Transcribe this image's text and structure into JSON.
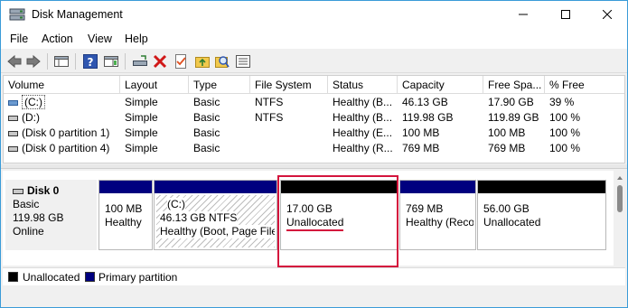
{
  "window": {
    "title": "Disk Management"
  },
  "menu": [
    "File",
    "Action",
    "View",
    "Help"
  ],
  "volume_table": {
    "headers": [
      "Volume",
      "Layout",
      "Type",
      "File System",
      "Status",
      "Capacity",
      "Free Spa...",
      "% Free"
    ],
    "rows": [
      {
        "volume": "(C:)",
        "layout": "Simple",
        "type": "Basic",
        "fs": "NTFS",
        "status": "Healthy (B...",
        "capacity": "46.13 GB",
        "free": "17.90 GB",
        "pct": "39 %"
      },
      {
        "volume": "(D:)",
        "layout": "Simple",
        "type": "Basic",
        "fs": "NTFS",
        "status": "Healthy (B...",
        "capacity": "119.98 GB",
        "free": "119.89 GB",
        "pct": "100 %"
      },
      {
        "volume": "(Disk 0 partition 1)",
        "layout": "Simple",
        "type": "Basic",
        "fs": "",
        "status": "Healthy (E...",
        "capacity": "100 MB",
        "free": "100 MB",
        "pct": "100 %"
      },
      {
        "volume": "(Disk 0 partition 4)",
        "layout": "Simple",
        "type": "Basic",
        "fs": "",
        "status": "Healthy (R...",
        "capacity": "769 MB",
        "free": "769 MB",
        "pct": "100 %"
      }
    ]
  },
  "disk": {
    "name": "Disk 0",
    "type": "Basic",
    "size": "119.98 GB",
    "state": "Online",
    "partitions": [
      {
        "line1": "100 MB",
        "line2": "Healthy",
        "kind": "primary"
      },
      {
        "title": "(C:)",
        "line1": "46.13 GB NTFS",
        "line2": "Healthy (Boot, Page File",
        "kind": "primary-selected"
      },
      {
        "line1": "17.00 GB",
        "line2": "Unallocated",
        "kind": "unallocated"
      },
      {
        "line1": "769 MB",
        "line2": "Healthy (Reco",
        "kind": "primary"
      },
      {
        "line1": "56.00 GB",
        "line2": "Unallocated",
        "kind": "unallocated"
      }
    ]
  },
  "legend": [
    {
      "label": "Unallocated",
      "color": "#000000"
    },
    {
      "label": "Primary partition",
      "color": "#00007f"
    }
  ],
  "colors": {
    "primary": "#00007f",
    "unallocated": "#000000",
    "highlight": "#d4143d",
    "window_border": "#3a9bd8"
  }
}
